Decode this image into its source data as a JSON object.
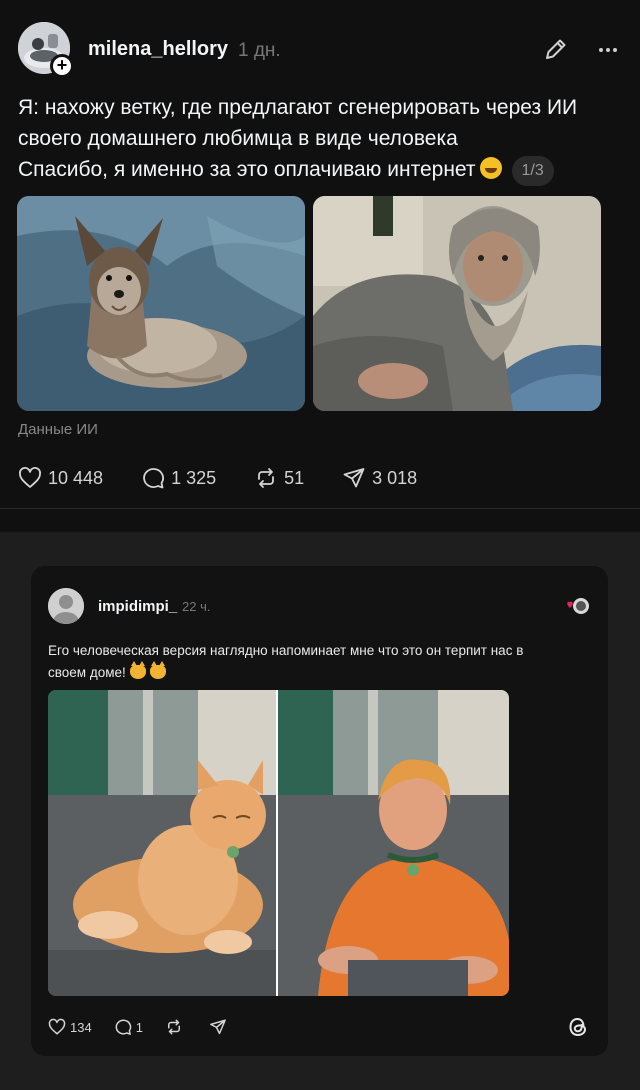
{
  "post": {
    "username": "milena_hellory",
    "time": "1 дн.",
    "text_lines": [
      "Я: нахожу ветку, где предлагают сгенерировать через ИИ",
      "своего домашнего любимца в виде человека",
      "Спасибо, я именно за это оплачиваю интернет"
    ],
    "page_counter": "1/3",
    "ai_label": "Данные ИИ",
    "stats": {
      "likes": "10 448",
      "comments": "1 325",
      "reposts": "51",
      "shares": "3 018"
    }
  },
  "embedded": {
    "username": "impidimpi_",
    "time": "22 ч.",
    "text_line1": "Его человеческая версия наглядно напоминает мне что это он терпит нас в",
    "text_line2": "своем доме!",
    "stats": {
      "likes": "134",
      "comments": "1"
    }
  },
  "colors": {
    "background": "#101010",
    "card_background": "#121212",
    "band": "#1e1e1e",
    "muted_text": "#777777"
  },
  "icons": [
    "edit-icon",
    "more-icon",
    "heart-icon",
    "comment-icon",
    "repost-icon",
    "share-icon",
    "threads-logo-icon"
  ]
}
